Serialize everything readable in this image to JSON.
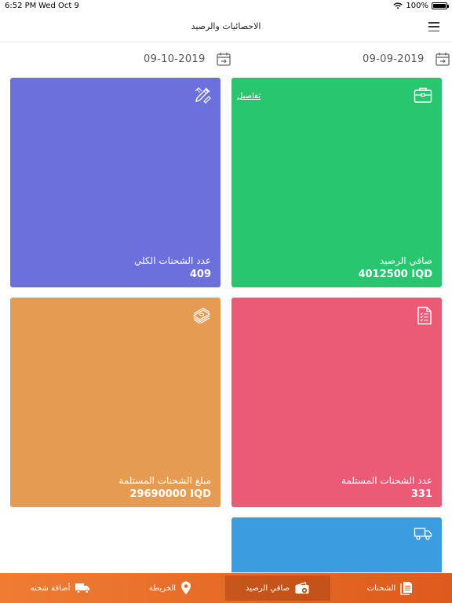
{
  "status_bar": {
    "time": "6:52 PM",
    "date": "Wed Oct 9",
    "battery": "100%"
  },
  "header": {
    "title": "الاحصائيات والرصيد"
  },
  "dates": {
    "from": "09-09-2019",
    "to": "09-10-2019"
  },
  "cards": {
    "balance": {
      "label": "صافي الرصيد",
      "value": "4012500 IQD",
      "details": "تفاصيل",
      "color": "#28c76f"
    },
    "total_shipments": {
      "label": "عدد الشحنات الكلي",
      "value": "409",
      "color": "#6c70dc"
    },
    "received_count": {
      "label": "عدد الشحنات المستلمة",
      "value": "331",
      "color": "#ec5b76"
    },
    "received_amount": {
      "label": "مبلغ الشحنات المستلمة",
      "value": "29690000 IQD",
      "color": "#e69b52"
    },
    "delivery": {
      "color": "#3b9de0"
    }
  },
  "bottom_nav": {
    "shipments": "الشحنات",
    "balance": "صافي الرصيد",
    "map": "الخريطة",
    "add_shipment": "أضافة شحنه",
    "active": "balance",
    "color": "#e46a26"
  },
  "icons": [
    "wifi-icon",
    "battery-icon",
    "menu-icon",
    "calendar-icon",
    "briefcase-icon",
    "pen-ruler-icon",
    "checklist-icon",
    "money-stack-icon",
    "truck-icon",
    "document-icon",
    "wallet-icon",
    "map-pin-icon"
  ]
}
